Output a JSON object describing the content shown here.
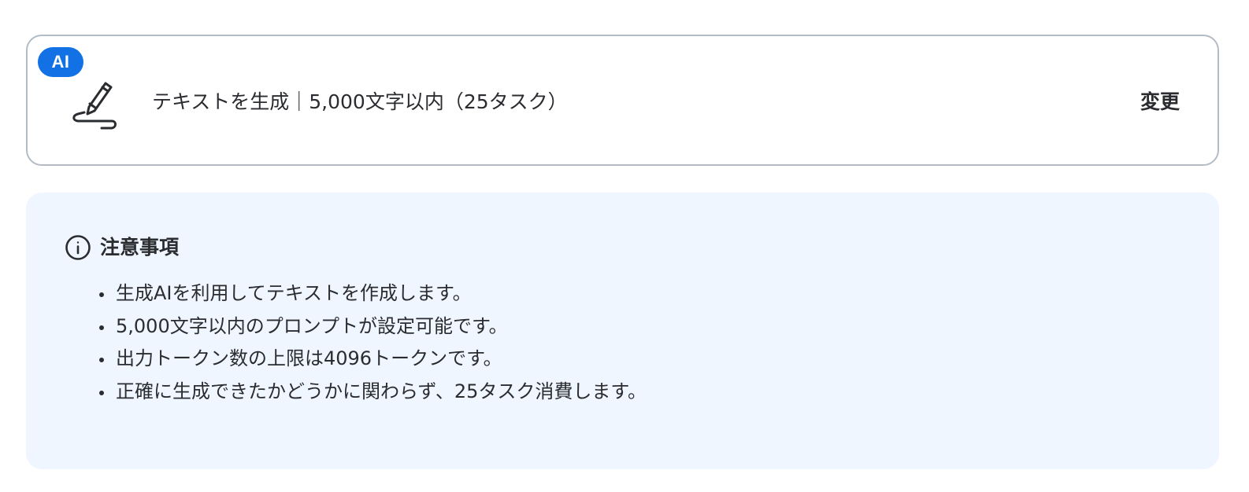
{
  "action": {
    "badge": "AI",
    "icon": "pen-writing-icon",
    "title": "テキストを生成｜5,000文字以内（25タスク）",
    "change_label": "変更"
  },
  "notes": {
    "icon": "info-icon",
    "title": "注意事項",
    "items": [
      "生成AIを利用してテキストを作成します。",
      "5,000文字以内のプロンプトが設定可能です。",
      "出力トークン数の上限は4096トークンです。",
      "正確に生成できたかどうかに関わらず、25タスク消費します。"
    ]
  },
  "colors": {
    "badge_bg": "#1371e6",
    "card_border": "#b3bcc4",
    "notes_bg": "#f0f6ff",
    "text": "#2a2c30"
  }
}
